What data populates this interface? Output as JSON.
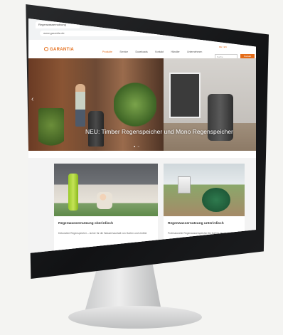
{
  "browser": {
    "tab_title": "Regenwassernutzung",
    "url": "www.garantia.de"
  },
  "site": {
    "logo_text": "GARANTIA",
    "lang": "DE / EN",
    "menu": [
      "Produkte",
      "Service",
      "Downloads",
      "Kontakt",
      "Händler",
      "Unternehmen"
    ],
    "active_menu_index": 0,
    "search_placeholder": "Suche",
    "cta_label": "Kontakt"
  },
  "hero": {
    "caption": "NEU: Timber Regenspeicher und Mono Regenspeicher",
    "prev_arrow": "‹",
    "dots": "● ○"
  },
  "cards": [
    {
      "title": "Regenwassernutzung oberirdisch",
      "text": "Dekorative Regenspeicher – sicher für die Wasserhaushalt von Garten und Umfeld"
    },
    {
      "title": "Regenwassernutzung unterirdisch",
      "text": "Professionelle Regenwasserspeicher für Garten, Haus und Gewerbe"
    }
  ],
  "colors": {
    "accent": "#e46d1a",
    "bezel": "#111214",
    "background": "#f4f4f2"
  }
}
